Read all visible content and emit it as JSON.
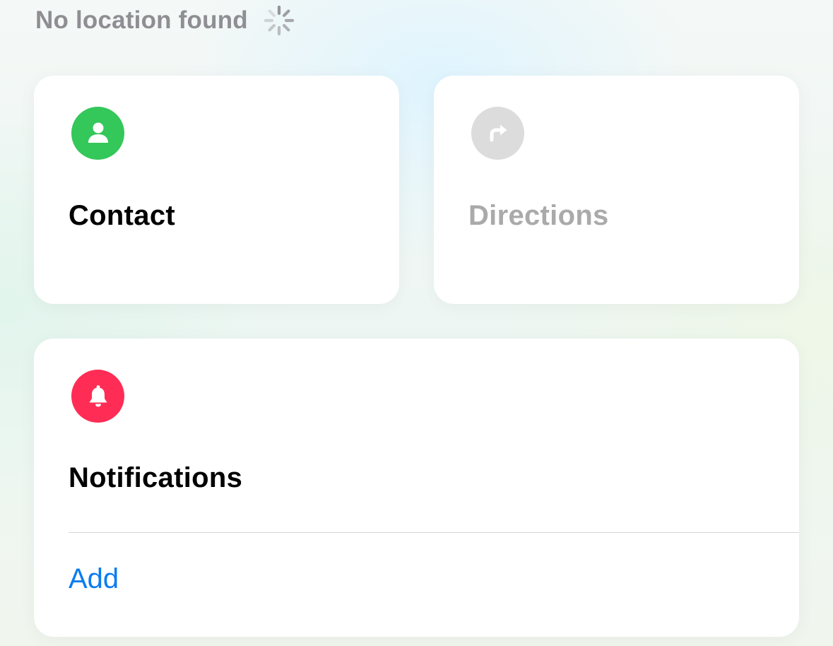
{
  "status": {
    "text": "No location found",
    "icon": "activity-spinner-icon"
  },
  "cards": {
    "contact": {
      "label": "Contact",
      "icon": "person-icon",
      "icon_color": "#34c759",
      "enabled": true
    },
    "directions": {
      "label": "Directions",
      "icon": "turn-right-arrow-icon",
      "icon_color": "#dcdcdc",
      "enabled": false
    },
    "notifications": {
      "label": "Notifications",
      "icon": "bell-icon",
      "icon_color": "#ff2d55",
      "add_label": "Add"
    }
  },
  "colors": {
    "primary_text": "#000000",
    "secondary_text": "#8e8e93",
    "disabled_text": "#aaaaaa",
    "link": "#0a7cf0"
  }
}
